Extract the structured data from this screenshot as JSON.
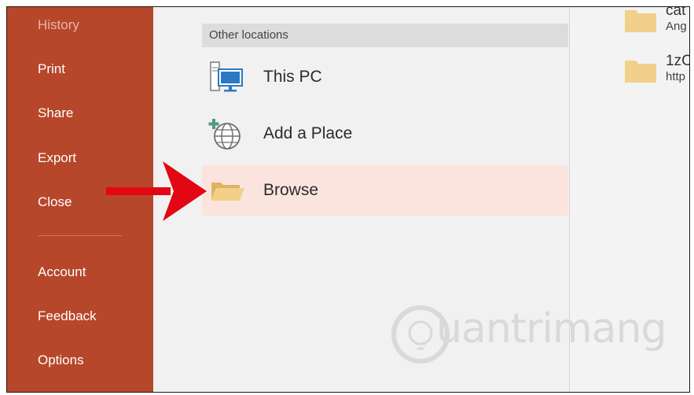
{
  "sidebar": {
    "items": [
      {
        "label": "History"
      },
      {
        "label": "Print"
      },
      {
        "label": "Share"
      },
      {
        "label": "Export"
      },
      {
        "label": "Close"
      },
      {
        "label": "Account"
      },
      {
        "label": "Feedback"
      },
      {
        "label": "Options"
      }
    ]
  },
  "main": {
    "section_title": "Other locations",
    "locations": [
      {
        "label": "This PC",
        "icon": "computer-icon"
      },
      {
        "label": "Add a Place",
        "icon": "globe-add-icon"
      },
      {
        "label": "Browse",
        "icon": "folder-icon",
        "selected": true
      }
    ]
  },
  "recent": {
    "items": [
      {
        "name": "cat",
        "path": "Ang"
      },
      {
        "name": "1zC",
        "path": "http"
      }
    ]
  },
  "annotation": {
    "icon": "red-arrow-icon",
    "color": "#e30613"
  },
  "watermark": {
    "text": "uantrimang"
  },
  "colors": {
    "sidebar": "#b7472a",
    "selected_row": "#fce4de",
    "folder": "#f0d08a"
  }
}
